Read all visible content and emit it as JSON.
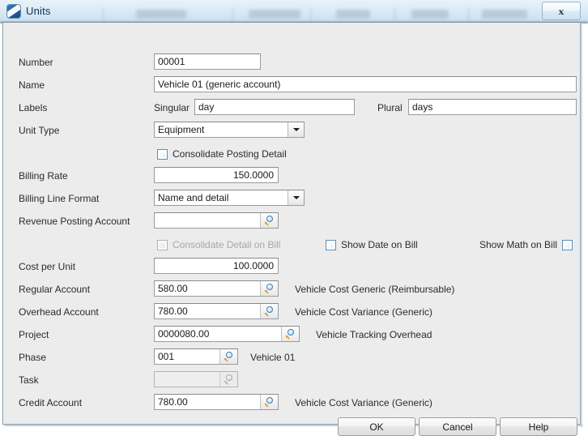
{
  "window": {
    "title": "Units",
    "icon": "app-icon",
    "close_label": "✕",
    "close_icon": "close-icon"
  },
  "form": {
    "number": {
      "label": "Number",
      "value": "00001"
    },
    "name": {
      "label": "Name",
      "value": "Vehicle 01 (generic account)"
    },
    "labels": {
      "label": "Labels",
      "singular_label": "Singular",
      "singular_value": "day",
      "plural_label": "Plural",
      "plural_value": "days"
    },
    "unit_type": {
      "label": "Unit Type",
      "value": "Equipment",
      "arrow_icon": "chevron-down-icon"
    },
    "consolidate_posting_detail": {
      "label": "Consolidate Posting Detail",
      "checked": false,
      "enabled": true
    },
    "billing_rate": {
      "label": "Billing Rate",
      "value": "150.0000"
    },
    "billing_line_format": {
      "label": "Billing Line Format",
      "value": "Name and detail",
      "arrow_icon": "chevron-down-icon"
    },
    "revenue_posting_account": {
      "label": "Revenue Posting Account",
      "value": "",
      "lookup_icon": "magnifier-icon"
    },
    "consolidate_detail_on_bill": {
      "label": "Consolidate Detail on Bill",
      "checked": false,
      "enabled": false
    },
    "show_date_on_bill": {
      "label": "Show Date on Bill",
      "checked": false,
      "enabled": true
    },
    "show_math_on_bill": {
      "label": "Show Math on Bill",
      "checked": false,
      "enabled": true
    },
    "cost_per_unit": {
      "label": "Cost per Unit",
      "value": "100.0000"
    },
    "regular_account": {
      "label": "Regular Account",
      "value": "580.00",
      "description": "Vehicle Cost Generic (Reimbursable)",
      "lookup_icon": "magnifier-icon"
    },
    "overhead_account": {
      "label": "Overhead Account",
      "value": "780.00",
      "description": "Vehicle Cost Variance (Generic)",
      "lookup_icon": "magnifier-icon"
    },
    "project": {
      "label": "Project",
      "value": "0000080.00",
      "description": "Vehicle Tracking Overhead",
      "lookup_icon": "magnifier-icon"
    },
    "phase": {
      "label": "Phase",
      "value": "001",
      "description": "Vehicle 01",
      "lookup_icon": "magnifier-icon"
    },
    "task": {
      "label": "Task",
      "value": "",
      "description": "",
      "enabled": false,
      "lookup_icon": "magnifier-icon"
    },
    "credit_account": {
      "label": "Credit Account",
      "value": "780.00",
      "description": "Vehicle Cost Variance (Generic)",
      "lookup_icon": "magnifier-icon"
    }
  },
  "buttons": {
    "ok": "OK",
    "cancel": "Cancel",
    "help": "Help"
  },
  "colors": {
    "titlebar_gradient_start": "#e8f3fa",
    "titlebar_gradient_end": "#c3dcee",
    "dialog_background": "#ececec",
    "field_border": "#9b9b9b",
    "checkbox_border": "#5a8fb6",
    "magnifier_lens": "#3d7fb5",
    "magnifier_handle": "#d98b20",
    "title_text": "#12324f"
  }
}
